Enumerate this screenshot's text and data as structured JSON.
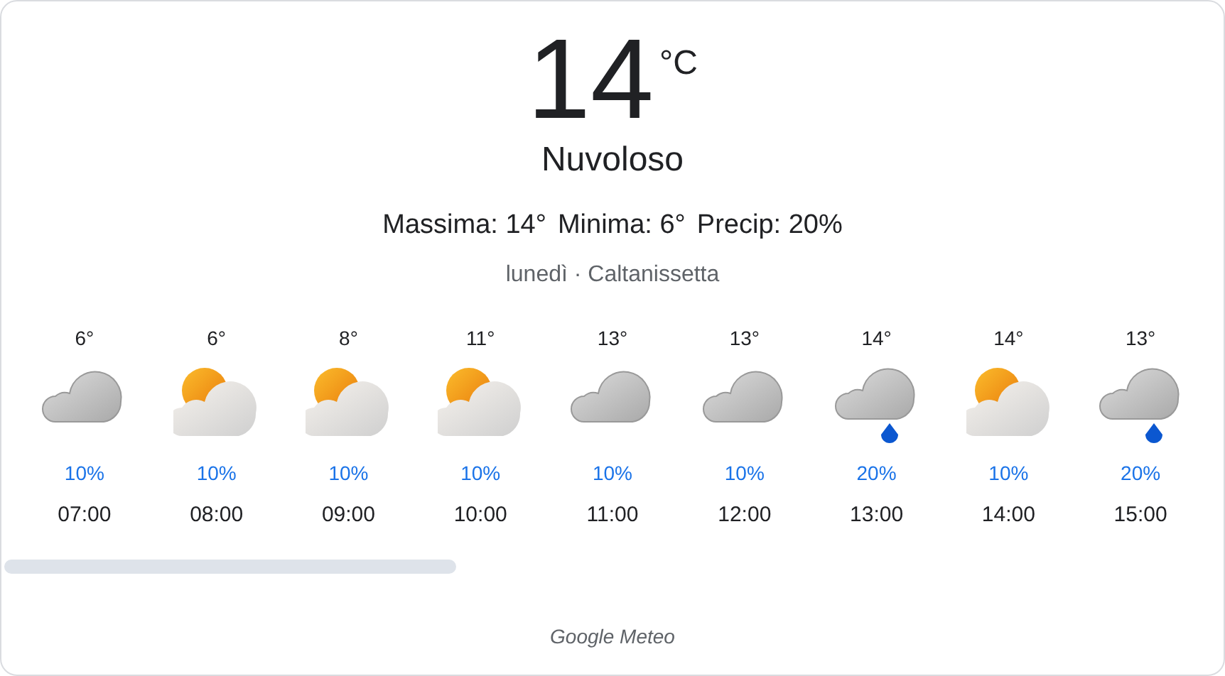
{
  "current": {
    "temperature": "14",
    "unit": "°C",
    "condition": "Nuvoloso"
  },
  "stats": [
    "Massima: 14°",
    "Minima: 6°",
    "Precip: 20%"
  ],
  "day_location": "lunedì · Caltanissetta",
  "hours": [
    {
      "temp": "6°",
      "kind": "cloudy",
      "precip": "10%",
      "time": "07:00"
    },
    {
      "temp": "6°",
      "kind": "partly-cloudy",
      "precip": "10%",
      "time": "08:00"
    },
    {
      "temp": "8°",
      "kind": "partly-cloudy",
      "precip": "10%",
      "time": "09:00"
    },
    {
      "temp": "11°",
      "kind": "partly-cloudy",
      "precip": "10%",
      "time": "10:00"
    },
    {
      "temp": "13°",
      "kind": "cloudy",
      "precip": "10%",
      "time": "11:00"
    },
    {
      "temp": "13°",
      "kind": "cloudy",
      "precip": "10%",
      "time": "12:00"
    },
    {
      "temp": "14°",
      "kind": "rain",
      "precip": "20%",
      "time": "13:00"
    },
    {
      "temp": "14°",
      "kind": "partly-cloudy",
      "precip": "10%",
      "time": "14:00"
    },
    {
      "temp": "13°",
      "kind": "rain",
      "precip": "20%",
      "time": "15:00"
    }
  ],
  "source": "Google Meteo"
}
